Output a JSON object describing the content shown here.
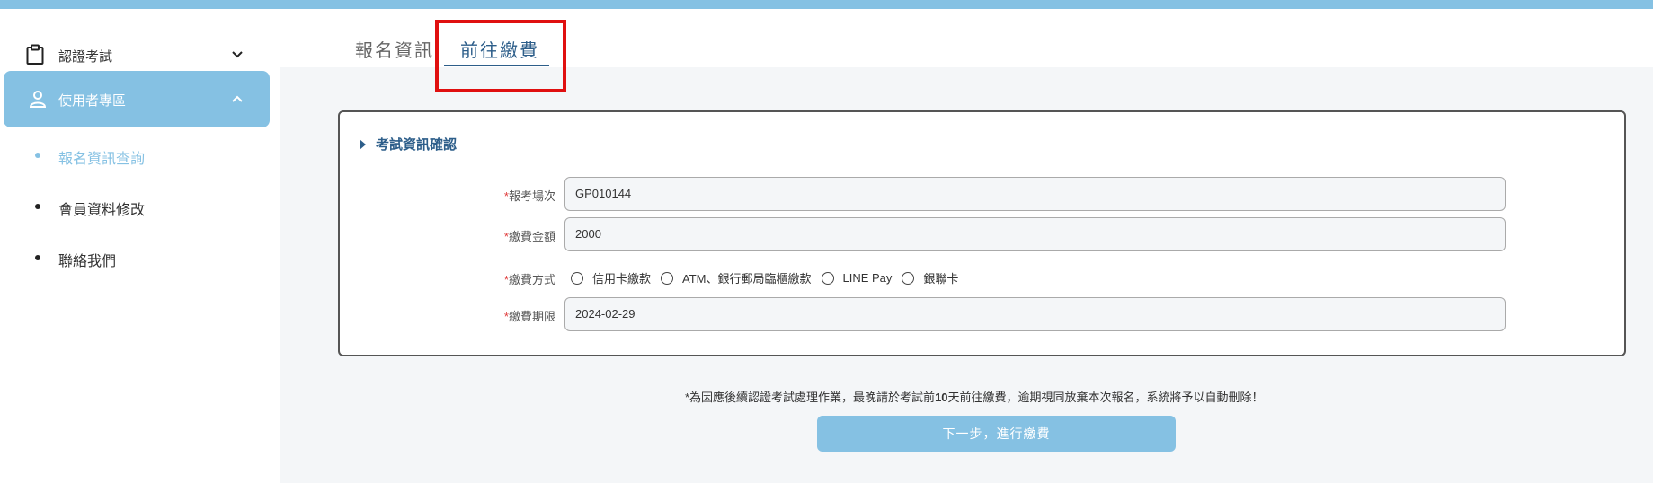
{
  "sidebar": {
    "certification": {
      "label": "認證考試",
      "icon": "clipboard-icon"
    },
    "user_zone": {
      "label": "使用者專區",
      "icon": "user-icon"
    },
    "items": [
      {
        "label": "報名資訊查詢",
        "active": true
      },
      {
        "label": "會員資料修改",
        "active": false
      },
      {
        "label": "聯絡我們",
        "active": false
      }
    ]
  },
  "tabs": [
    {
      "label": "報名資訊",
      "active": false
    },
    {
      "label": "前往繳費",
      "active": true
    }
  ],
  "form": {
    "section_title": "考試資訊確認",
    "exam_session": {
      "label": "報考場次",
      "value": "GP010144"
    },
    "amount": {
      "label": "繳費金額",
      "value": "2000"
    },
    "payment_method": {
      "label": "繳費方式",
      "options": [
        "信用卡繳款",
        "ATM、銀行郵局臨櫃繳款",
        "LINE Pay",
        "銀聯卡"
      ]
    },
    "deadline": {
      "label": "繳費期限",
      "value": "2024-02-29"
    }
  },
  "notice": {
    "prefix": "*為因應後續認證考試處理作業，最晚請於考試前",
    "bold": "10",
    "suffix": "天前往繳費，逾期視同放棄本次報名，系統將予以自動刪除！"
  },
  "next_button": "下一步，進行繳費",
  "colors": {
    "accent": "#85c1e3",
    "tab_active": "#2d5e8a",
    "highlight": "#e01010",
    "required": "#e03a3a"
  }
}
